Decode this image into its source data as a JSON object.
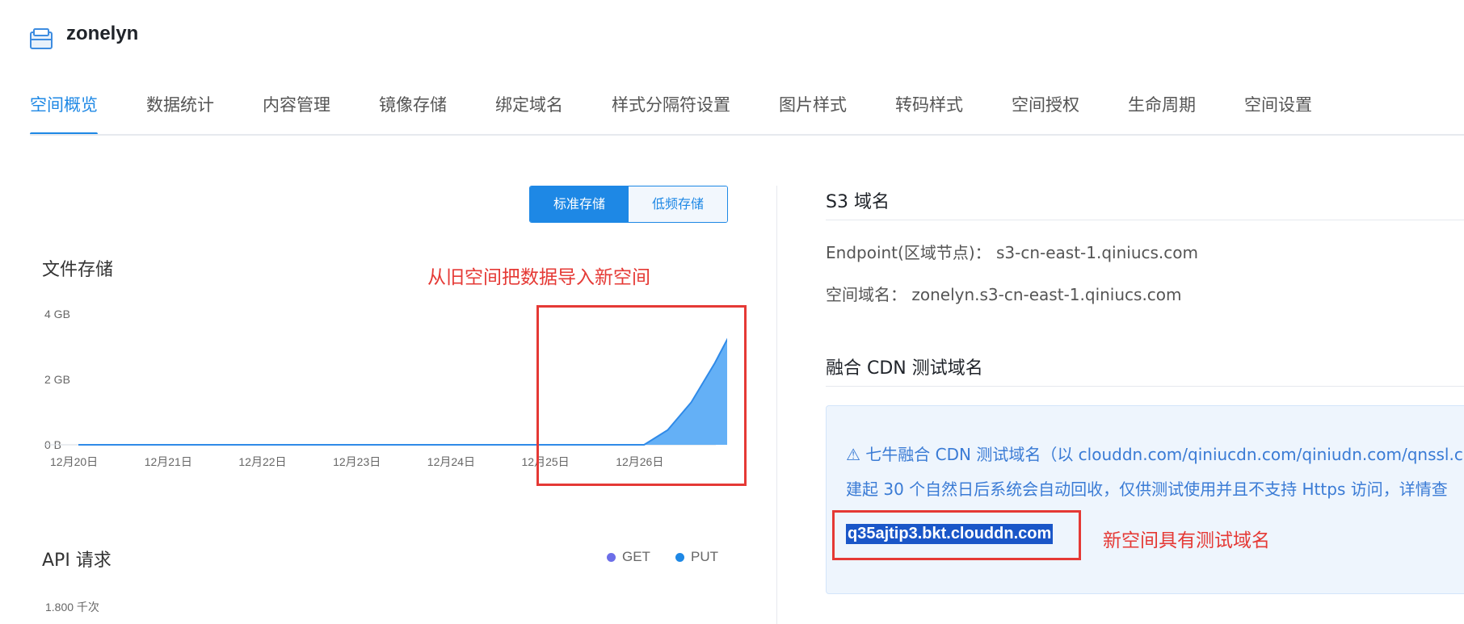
{
  "header": {
    "bucket_name": "zonelyn"
  },
  "tabs": [
    {
      "label": "空间概览",
      "active": true
    },
    {
      "label": "数据统计"
    },
    {
      "label": "内容管理"
    },
    {
      "label": "镜像存储"
    },
    {
      "label": "绑定域名"
    },
    {
      "label": "样式分隔符设置"
    },
    {
      "label": "图片样式"
    },
    {
      "label": "转码样式"
    },
    {
      "label": "空间授权"
    },
    {
      "label": "生命周期"
    },
    {
      "label": "空间设置"
    }
  ],
  "storage_toggle": {
    "standard": "标准存储",
    "low_freq": "低频存储",
    "selected": "standard"
  },
  "file_storage": {
    "title": "文件存储",
    "annotation": "从旧空间把数据导入新空间",
    "chart_data": {
      "type": "area",
      "title": "文件存储",
      "y_ticks": [
        "4 GB",
        "2 GB",
        "0 B"
      ],
      "ylim": [
        0,
        4
      ],
      "x_ticks": [
        "12月20日",
        "12月21日",
        "12月22日",
        "12月23日",
        "12月24日",
        "12月25日",
        "12月26日"
      ],
      "series": [
        {
          "x": [
            0,
            1,
            2,
            3,
            4,
            5,
            6.0,
            6.25,
            6.5,
            6.75,
            6.95
          ],
          "values": [
            0,
            0,
            0,
            0,
            0,
            0,
            0,
            0.45,
            1.3,
            2.5,
            3.6
          ]
        }
      ]
    }
  },
  "api_requests": {
    "title": "API 请求",
    "legend": [
      {
        "name": "GET",
        "color": "#6c6ee8"
      },
      {
        "name": "PUT",
        "color": "#1e88e5"
      }
    ],
    "y_top_label": "1.800 千次"
  },
  "s3": {
    "title": "S3 域名",
    "endpoint_label": "Endpoint(区域节点)：",
    "endpoint_value": "s3-cn-east-1.qiniucs.com",
    "domain_label": "空间域名：",
    "domain_value": "zonelyn.s3-cn-east-1.qiniucs.com"
  },
  "cdn": {
    "title": "融合 CDN 测试域名",
    "notice_line1": "⚠ 七牛融合 CDN 测试域名（以 clouddn.com/qiniucdn.com/qiniudn.com/qnssl.c",
    "notice_line2": "建起 30 个自然日后系统会自动回收，仅供测试使用并且不支持 Https 访问，详情查",
    "test_domain": "q35ajtip3.bkt.clouddn.com",
    "annotation": "新空间具有测试域名"
  },
  "colors": {
    "accent": "#1e88e5",
    "annotation_red": "#e53935",
    "area_fill": "#64b0f6"
  }
}
